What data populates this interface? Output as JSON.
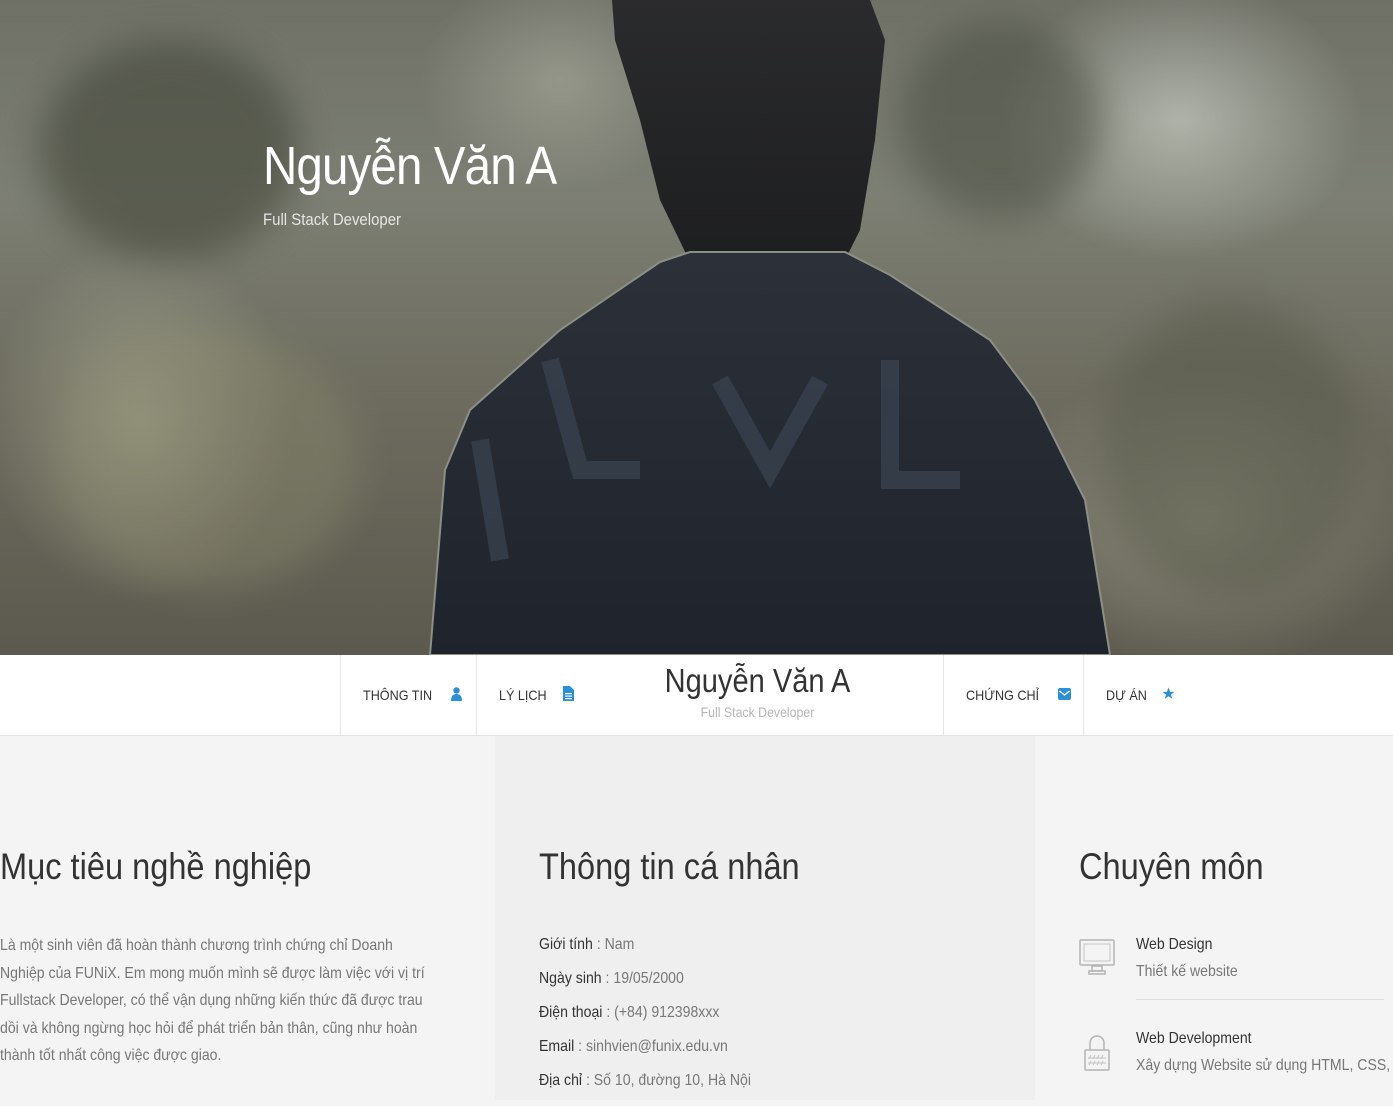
{
  "hero": {
    "title": "Nguyễn Văn A",
    "subtitle": "Full Stack Developer"
  },
  "nav": {
    "items": [
      {
        "label": "THÔNG TIN",
        "icon": "user-icon"
      },
      {
        "label": "LÝ LỊCH",
        "icon": "document-icon"
      },
      {
        "label": "CHỨNG CHỈ",
        "icon": "envelope-icon"
      },
      {
        "label": "DỰ ÁN",
        "icon": "star-icon"
      }
    ],
    "brand": {
      "name": "Nguyễn Văn A",
      "subtitle": "Full Stack Developer"
    },
    "accent_color": "#2a8fd6"
  },
  "objective": {
    "title": "Mục tiêu nghề nghiệp",
    "text": "Là một sinh viên đã hoàn thành chương trình chứng chỉ Doanh Nghiệp của FUNiX. Em mong muốn mình sẽ được làm việc với vị trí Fullstack Developer, có thể vận dụng những kiến thức đã được trau dồi và không ngừng học hỏi để phát triển bản thân, cũng như hoàn thành tốt nhất công việc được giao."
  },
  "personal": {
    "title": "Thông tin cá nhân",
    "rows": [
      {
        "key": "Giới tính",
        "value": "Nam"
      },
      {
        "key": "Ngày sinh",
        "value": "19/05/2000"
      },
      {
        "key": "Điện thoại",
        "value": "(+84) 912398xxx"
      },
      {
        "key": "Email",
        "value": "sinhvien@funix.edu.vn"
      },
      {
        "key": "Địa chỉ",
        "value": "Số 10, đường 10, Hà Nội"
      }
    ]
  },
  "expertise": {
    "title": "Chuyên môn",
    "skills": [
      {
        "title": "Web Design",
        "desc": "Thiết kế website",
        "icon": "monitor-icon"
      },
      {
        "title": "Web Development",
        "desc": "Xây dựng Website sử dụng HTML, CSS, JS",
        "icon": "lock-icon"
      }
    ]
  }
}
